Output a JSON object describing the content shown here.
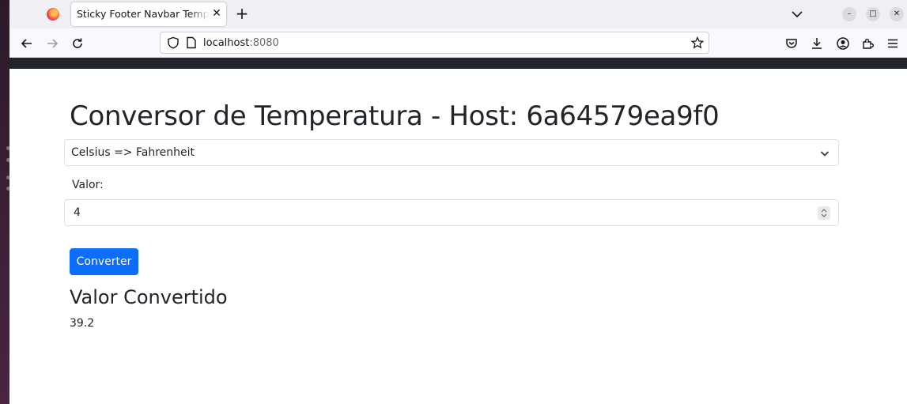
{
  "browser": {
    "tab_title": "Sticky Footer Navbar Template",
    "url_host": "localhost",
    "url_port": ":8080",
    "icons": {
      "logo": "firefox-icon",
      "close_tab": "close-icon",
      "new_tab": "plus-icon",
      "tab_list": "chevron-down-icon",
      "back": "arrow-left-icon",
      "forward": "arrow-right-icon",
      "reload": "reload-icon",
      "site_info": "shield-icon",
      "page": "page-icon",
      "bookmark": "star-icon",
      "pocket": "pocket-icon",
      "downloads": "download-icon",
      "account": "account-icon",
      "extensions": "puzzle-icon",
      "menu": "hamburger-icon"
    }
  },
  "page": {
    "title": "Conversor de Temperatura - Host: 6a64579ea9f0",
    "conversion_select": "Celsius => Fahrenheit",
    "value_label": "Valor:",
    "value_input": "4",
    "convert_button": "Converter",
    "result_heading": "Valor Convertido",
    "result_value": "39.2"
  },
  "colors": {
    "primary": "#0d6efd",
    "navbar_dark": "#212529",
    "text": "#212529"
  }
}
